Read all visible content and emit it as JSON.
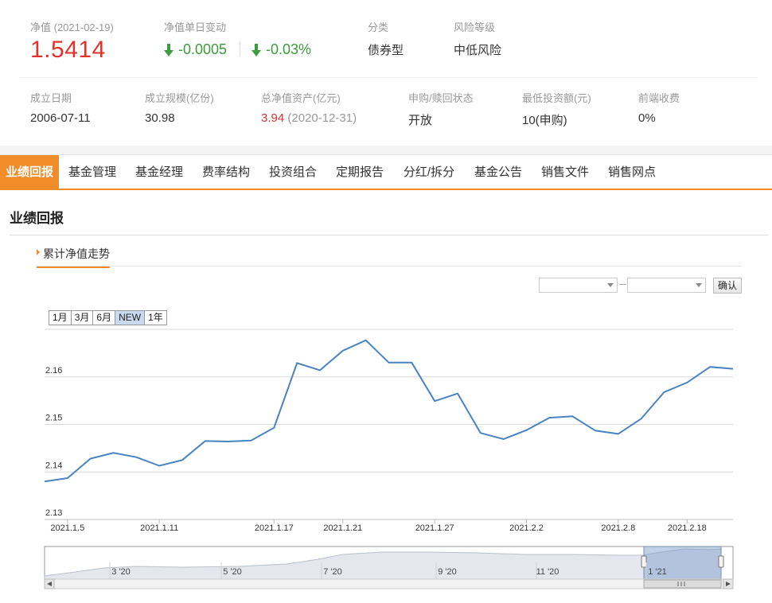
{
  "summary": {
    "nav_label": "净值 (2021-02-19)",
    "nav_value": "1.5414",
    "change_label": "净值单日变动",
    "change_abs": "-0.0005",
    "change_pct": "-0.03%",
    "category_label": "分类",
    "category_value": "债券型",
    "risk_label": "风险等级",
    "risk_value": "中低风险",
    "founded_label": "成立日期",
    "founded_value": "2006-07-11",
    "scale_label": "成立规模(亿份)",
    "scale_value": "30.98",
    "assets_label": "总净值资产(亿元)",
    "assets_value": "3.94",
    "assets_date": "(2020-12-31)",
    "status_label": "申购/赎回状态",
    "status_value": "开放",
    "min_label": "最低投资额(元)",
    "min_value": "10(申购)",
    "fee_label": "前端收费",
    "fee_value": "0%"
  },
  "tabs": [
    "业绩回报",
    "基金管理",
    "基金经理",
    "费率结构",
    "投资组合",
    "定期报告",
    "分红/拆分",
    "基金公告",
    "销售文件",
    "销售网点"
  ],
  "section_title": "业绩回报",
  "sub_tab": "累计净值走势",
  "confirm_label": "确认",
  "range_buttons": [
    "1月",
    "3月",
    "6月",
    "NEW",
    "1年"
  ],
  "colors": {
    "accent": "#f08c2a",
    "line": "#4a83c2",
    "red": "#e0322a",
    "green": "#3b9e3b"
  },
  "chart_data": {
    "type": "line",
    "ylim": [
      2.13,
      2.17
    ],
    "yticks": [
      "2.13",
      "2.14",
      "2.15",
      "2.16"
    ],
    "xtick_labels": [
      "2021.1.5",
      "2021.1.11",
      "2021.1.17",
      "2021.1.21",
      "2021.1.27",
      "2021.2.2",
      "2021.2.8",
      "2021.2.18"
    ],
    "xtick_index": [
      1,
      5,
      10,
      13,
      17,
      21,
      25,
      28
    ],
    "values": [
      2.138,
      2.1387,
      2.1428,
      2.144,
      2.1431,
      2.1413,
      2.1425,
      2.1465,
      2.1464,
      2.1466,
      2.1493,
      2.1629,
      2.1614,
      2.1655,
      2.1677,
      2.163,
      2.163,
      2.1549,
      2.1565,
      2.1482,
      2.1469,
      2.1488,
      2.1514,
      2.1517,
      2.1487,
      2.148,
      2.1512,
      2.1568,
      2.1588,
      2.1621,
      2.1617
    ],
    "navigator_labels": [
      "3 '20",
      "5 '20",
      "7 '20",
      "9 '20",
      "11 '20",
      "1 '21"
    ]
  }
}
